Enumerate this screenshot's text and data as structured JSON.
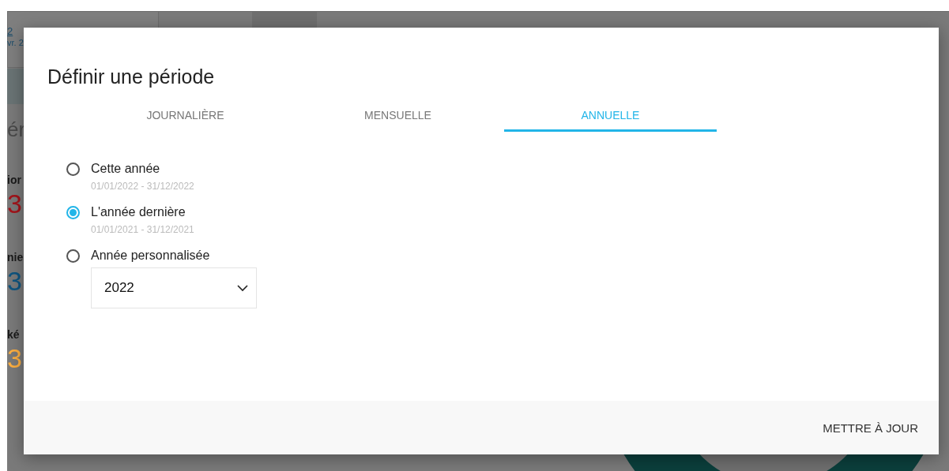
{
  "background": {
    "fragments": [
      {
        "text": "2",
        "kind": "link"
      },
      {
        "text": "vr. 2",
        "kind": "link"
      },
      {
        "text": "ér",
        "kind": "heading"
      },
      {
        "text": "ior",
        "kind": "label"
      },
      {
        "text": "3",
        "kind": "value",
        "color": "#a3141b"
      },
      {
        "text": "nie",
        "kind": "label"
      },
      {
        "text": "3",
        "kind": "value",
        "color": "#0f5580"
      },
      {
        "text": "ké",
        "kind": "label"
      },
      {
        "text": "3",
        "kind": "value",
        "color": "#ffb040"
      }
    ]
  },
  "dialog": {
    "title": "Définir une période",
    "tabs": [
      {
        "label": "JOURNALIÈRE",
        "selected": false
      },
      {
        "label": "MENSUELLE",
        "selected": false
      },
      {
        "label": "ANNUELLE",
        "selected": true
      }
    ],
    "options": [
      {
        "label": "Cette année",
        "dates": "01/01/2022 - 31/12/2022",
        "selected": false
      },
      {
        "label": "L'année dernière",
        "dates": "01/01/2021 - 31/12/2021",
        "selected": true
      },
      {
        "label": "Année personnalisée",
        "select": {
          "value": "2022"
        },
        "selected": false
      }
    ],
    "button": "METTRE À JOUR"
  }
}
